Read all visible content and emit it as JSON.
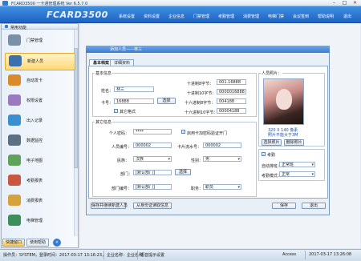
{
  "window": {
    "title": "FCARD3500 一卡通管理系统  Ver 6.5.7.0",
    "min": "–",
    "max": "□",
    "close": "✕"
  },
  "banner": {
    "brand": "FCARD3500",
    "menu": [
      "系统设置",
      "资料设置",
      "企业信息",
      "门禁管理",
      "考勤管理",
      "消费管理",
      "电梯门禁",
      "会议签到",
      "帮助说明",
      "退出"
    ]
  },
  "sidebar": {
    "heading": "常用功能",
    "items": [
      {
        "label": "门禁管理",
        "icon": "door-icon",
        "color": "#7a8fa8"
      },
      {
        "label": "新建人员",
        "icon": "user-add-icon",
        "color": "#3a6fb0"
      },
      {
        "label": "自动发卡",
        "icon": "card-issue-icon",
        "color": "#d98a2a"
      },
      {
        "label": "权限设置",
        "icon": "permission-icon",
        "color": "#9b7bbf"
      },
      {
        "label": "出入记录",
        "icon": "access-record-icon",
        "color": "#3a8fd0"
      },
      {
        "label": "数据监控",
        "icon": "monitor-icon",
        "color": "#5d6f82"
      },
      {
        "label": "电子地图",
        "icon": "map-icon",
        "color": "#5fa25a"
      },
      {
        "label": "考勤报表",
        "icon": "attendance-icon",
        "color": "#c9563e"
      },
      {
        "label": "消费报表",
        "icon": "consume-icon",
        "color": "#d6a23a"
      },
      {
        "label": "电梯管理",
        "icon": "elevator-icon",
        "color": "#3e8e5c"
      }
    ],
    "tab_common": "快捷窗口",
    "tab_help": "使用帮助"
  },
  "dialog": {
    "title": "添加人员——林三",
    "tabs": [
      "基本档案",
      "详细资料"
    ],
    "basic_group": "基本信息",
    "name_label": "姓名：",
    "name_value": "林三",
    "card_label": "卡号：",
    "card_value": "16888",
    "select_card": "选择",
    "other_format": "其它格式",
    "hex_labels": [
      "十进制8字节：",
      "十进制10字节：",
      "十六进制8字节：",
      "十六进制10字节："
    ],
    "hex_values": [
      "001.16888",
      "0000016888",
      "004188",
      "00004188"
    ],
    "other_group": "其它信息",
    "pwd_label": "个人密码：",
    "pwd_value": "****",
    "pwd_open": "启用卡加密码验证开门",
    "empno_label": "人员编号：",
    "empno_value": "000002",
    "cardsn_label": "卡片流水号：",
    "cardsn_value": "000002",
    "ethnic_label": "民族：",
    "ethnic_value": "汉族",
    "gender_label": "性别：",
    "gender_value": "男",
    "dept_label": "部门：",
    "dept_value": "[默认部门]",
    "select_dept": "选择",
    "deptno_label": "部门编号：",
    "deptno_value": "[默认部门]",
    "job_label": "职务：",
    "job_value": "职员",
    "photo_label": "人员照片：",
    "photo_caption": [
      "320 X 140 像素",
      "照片不能大于3M"
    ],
    "select_photo": "选择照片",
    "delete_photo": "删除照片",
    "attendance_label": "考勤",
    "autoshift_label": "自动排班：",
    "autoshift_value": "正常班",
    "attmode_label": "考勤模式：",
    "attmode_value": "正常",
    "btn_save_new": "保存并继续新建人员",
    "btn_read_record": "从身份证读取信息",
    "btn_save": "保存",
    "btn_exit": "退出"
  },
  "status": {
    "operator": "操作员：SYSTEM，登录时间：2017-03-17 13:16:23，",
    "company": "企业名称：企业名称",
    "tip": "语音提示设置",
    "db": "Access",
    "time": "2017-03-17  13:26:08"
  }
}
